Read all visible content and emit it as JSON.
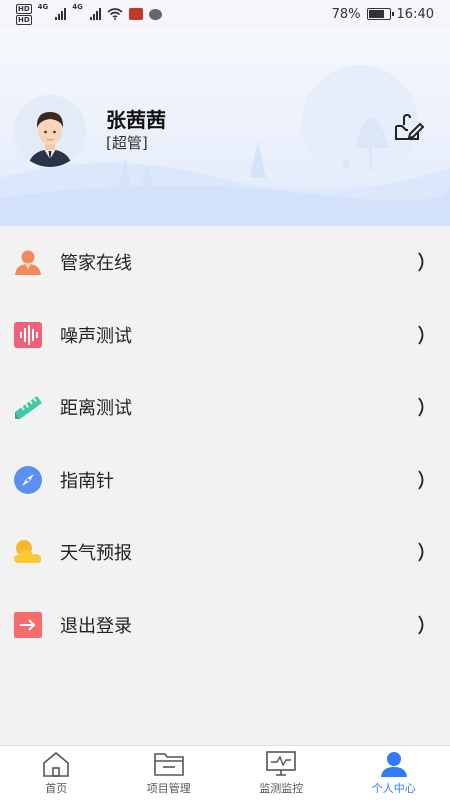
{
  "status_bar": {
    "sim1": "HD",
    "sim2": "HD",
    "net1": "4G",
    "net2": "4G",
    "battery": "78%",
    "time": "16:40"
  },
  "profile": {
    "name": "张茜茜",
    "role": "[超管]"
  },
  "menu": {
    "items": [
      {
        "label": "管家在线",
        "icon": "person-icon",
        "color": "#f08a5d"
      },
      {
        "label": "噪声测试",
        "icon": "sound-wave-icon",
        "color": "#f0607a"
      },
      {
        "label": "距离测试",
        "icon": "ruler-icon",
        "color": "#3ec9a7"
      },
      {
        "label": "指南针",
        "icon": "compass-icon",
        "color": "#5b8ff0"
      },
      {
        "label": "天气预报",
        "icon": "weather-icon",
        "color": "#f7b731"
      },
      {
        "label": "退出登录",
        "icon": "logout-icon",
        "color": "#f66b6b"
      }
    ],
    "chevron": "〉"
  },
  "bottom_nav": {
    "items": [
      {
        "label": "首页",
        "icon": "home-icon"
      },
      {
        "label": "项目管理",
        "icon": "folder-icon"
      },
      {
        "label": "监测监控",
        "icon": "monitor-icon"
      },
      {
        "label": "个人中心",
        "icon": "user-icon"
      }
    ],
    "active_index": 3,
    "active_color": "#2f7cf6"
  }
}
